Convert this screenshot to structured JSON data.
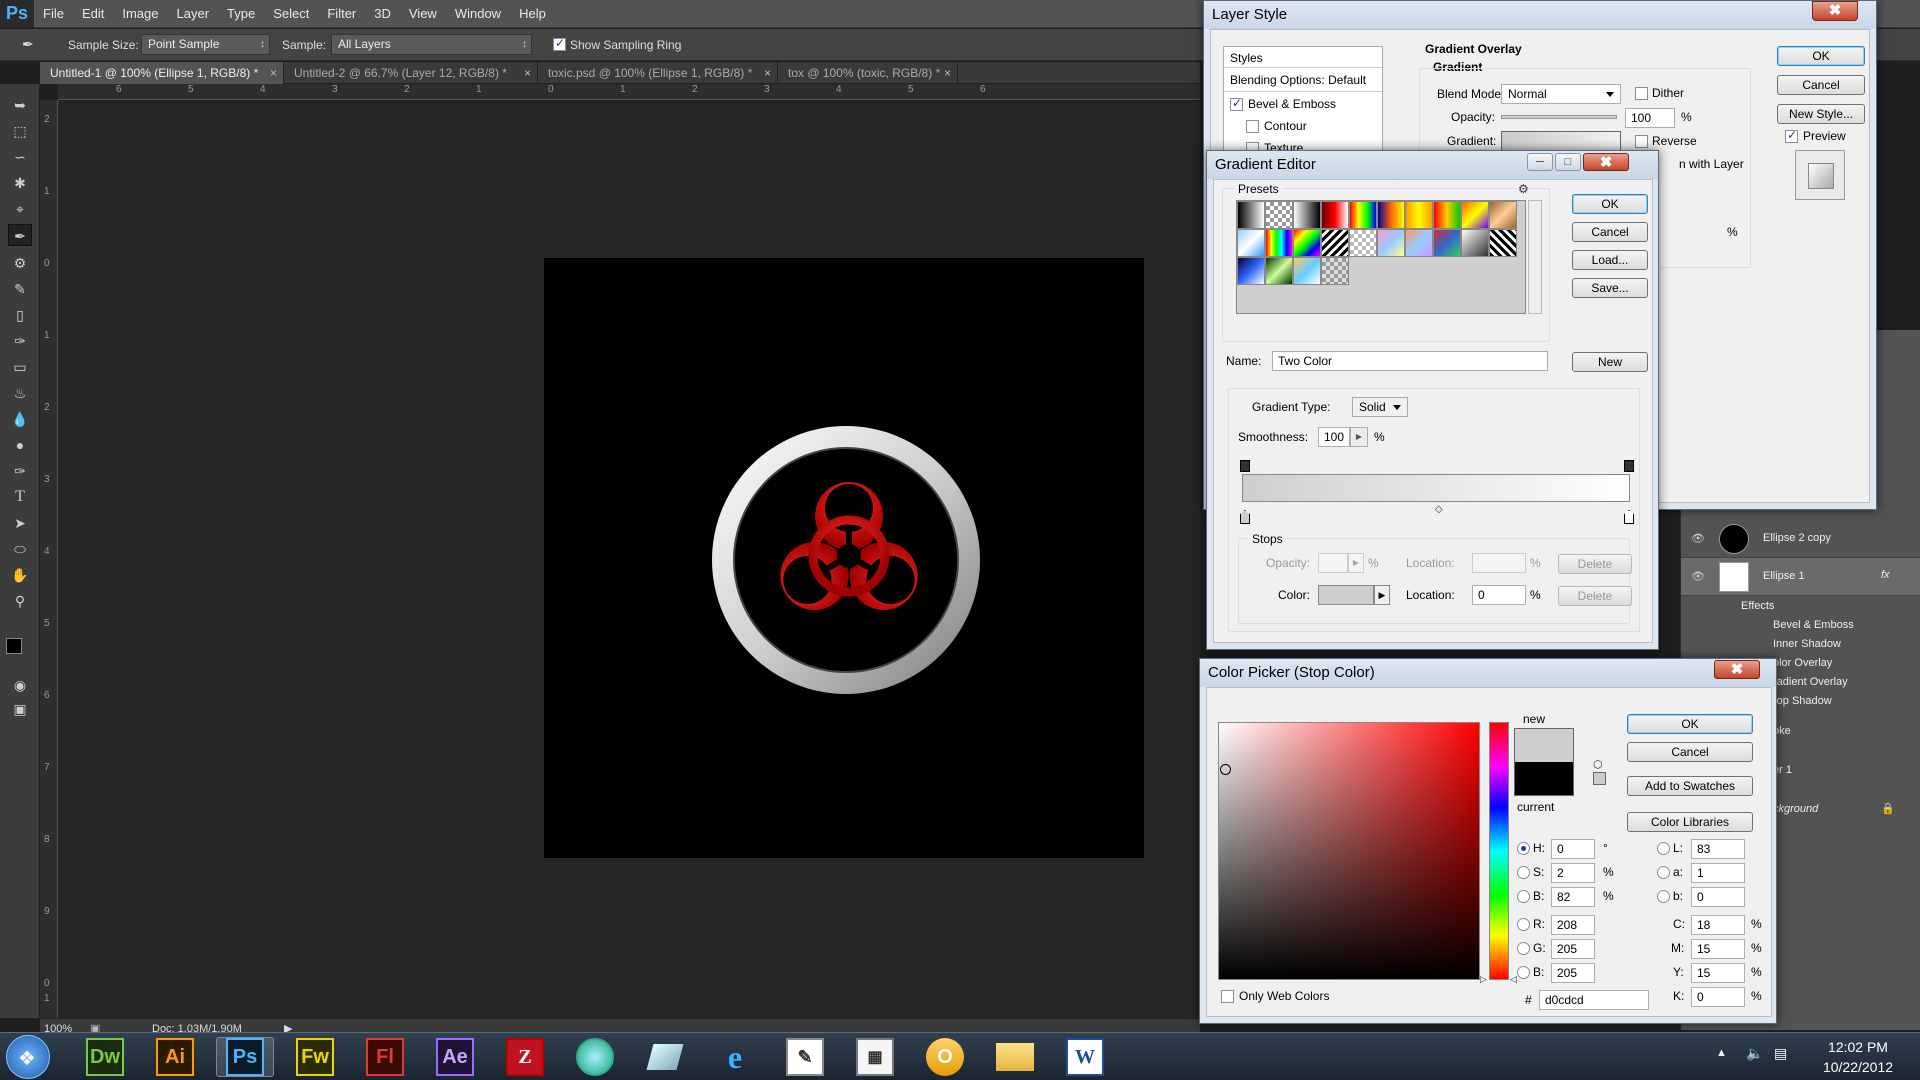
{
  "app": {
    "logo": "Ps"
  },
  "menu": [
    "File",
    "Edit",
    "Image",
    "Layer",
    "Type",
    "Select",
    "Filter",
    "3D",
    "View",
    "Window",
    "Help"
  ],
  "options": {
    "sample_size_label": "Sample Size:",
    "sample_size_value": "Point Sample",
    "sample_label": "Sample:",
    "sample_value": "All Layers",
    "sampling_ring": "Show Sampling Ring"
  },
  "tabs": [
    {
      "label": "Untitled-1 @ 100% (Ellipse 1, RGB/8) *",
      "close": "×"
    },
    {
      "label": "Untitled-2 @ 66.7% (Layer 12, RGB/8) *",
      "close": "×"
    },
    {
      "label": "toxic.psd @ 100% (Ellipse 1, RGB/8) *",
      "close": "×"
    },
    {
      "label": "tox @ 100% (toxic, RGB/8) *",
      "close": "×"
    }
  ],
  "ruler_top": [
    "6",
    "5",
    "4",
    "3",
    "2",
    "1",
    "0",
    "1",
    "2",
    "3",
    "4",
    "5",
    "6"
  ],
  "ruler_left": [
    "2",
    "1",
    "0",
    "1",
    "2",
    "3",
    "4",
    "5",
    "6",
    "7",
    "8",
    "9",
    "0",
    "1"
  ],
  "status": {
    "zoom": "100%",
    "doc": "Doc: 1.03M/1.90M"
  },
  "layers": {
    "rows": [
      "Ellipse 2 copy",
      "Ellipse 1"
    ],
    "fx": "fx",
    "effects_label": "Effects",
    "effects": [
      "Bevel & Emboss",
      "Inner Shadow",
      "olor Overlay",
      "radient Overlay",
      "rop Shadow"
    ],
    "more": [
      "oke",
      "er 1",
      "ckground"
    ]
  },
  "layer_style": {
    "title": "Layer Style",
    "close": "✖",
    "left_items": [
      "Styles",
      "Blending Options: Default",
      "Bevel & Emboss",
      "Contour",
      "Texture"
    ],
    "section": "Gradient Overlay",
    "subsection": "Gradient",
    "blend_mode_label": "Blend Mode:",
    "blend_mode": "Normal",
    "dither": "Dither",
    "opacity_label": "Opacity:",
    "opacity": "100",
    "pct": "%",
    "gradient_label": "Gradient:",
    "reverse": "Reverse",
    "align_with_layer": "n with Layer",
    "ok": "OK",
    "cancel": "Cancel",
    "new_style": "New Style...",
    "preview": "Preview"
  },
  "gradient_editor": {
    "title": "Gradient Editor",
    "presets_label": "Presets",
    "ok": "OK",
    "cancel": "Cancel",
    "load": "Load...",
    "save": "Save...",
    "name_label": "Name:",
    "name": "Two Color",
    "new": "New",
    "type_label": "Gradient Type:",
    "type": "Solid",
    "smoothness_label": "Smoothness:",
    "smoothness": "100",
    "pct": "%",
    "stops_label": "Stops",
    "opacity_label": "Opacity:",
    "location_label": "Location:",
    "delete": "Delete",
    "color_label": "Color:",
    "location_value": "0"
  },
  "color_picker": {
    "title": "Color Picker (Stop Color)",
    "new_label": "new",
    "current_label": "current",
    "ok": "OK",
    "cancel": "Cancel",
    "add_swatches": "Add to Swatches",
    "color_libraries": "Color Libraries",
    "only_web": "Only Web Colors",
    "H": "0",
    "S": "2",
    "B": "82",
    "R": "208",
    "G": "205",
    "Bv": "205",
    "L": "83",
    "a": "1",
    "b": "0",
    "C": "18",
    "M": "15",
    "Y": "15",
    "K": "0",
    "hex": "d0cdcd",
    "deg": "°",
    "pct": "%",
    "hash": "#",
    "labels": {
      "H": "H:",
      "S": "S:",
      "B": "B:",
      "R": "R:",
      "G": "G:",
      "Bv": "B:",
      "L": "L:",
      "a": "a:",
      "b": "b:",
      "C": "C:",
      "M": "M:",
      "Y": "Y:",
      "K": "K:"
    },
    "new_color": "#d0cdcd",
    "current_color": "#000000"
  },
  "taskbar": {
    "apps": [
      {
        "name": "Dw",
        "color": "#7ac943",
        "bg": "#1b2b0f"
      },
      {
        "name": "Ai",
        "color": "#ff9a00",
        "bg": "#2b1a00"
      },
      {
        "name": "Ps",
        "color": "#4bb4ff",
        "bg": "#0a1b2b"
      },
      {
        "name": "Fw",
        "color": "#e6d800",
        "bg": "#2b2a00"
      },
      {
        "name": "Fl",
        "color": "#e23b2e",
        "bg": "#3a0805"
      },
      {
        "name": "Ae",
        "color": "#c7a6ff",
        "bg": "#1e1235"
      }
    ],
    "time": "12:02 PM",
    "date": "10/22/2012"
  }
}
